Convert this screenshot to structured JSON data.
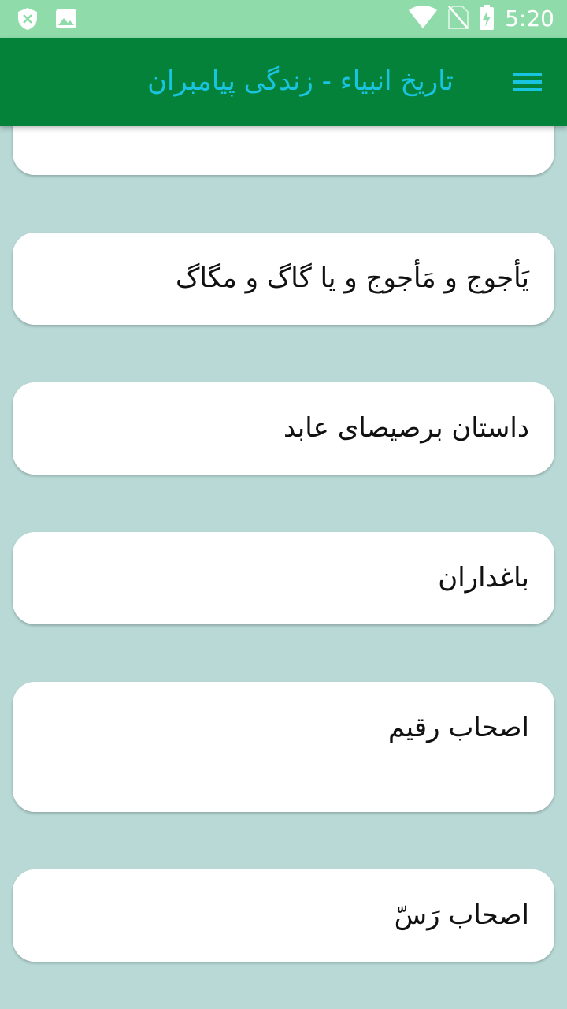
{
  "status_bar": {
    "time": "5:20",
    "icons": [
      "shield-icon",
      "image-icon",
      "wifi-icon",
      "no-sim-icon",
      "battery-charging-icon"
    ]
  },
  "app_bar": {
    "title": "تاریخ انبیاء - زندگی پیامبران",
    "menu_icon": "hamburger-menu-icon"
  },
  "items": [
    {
      "label": ""
    },
    {
      "label": "یَأجوج و مَأجوج و یا گاگ و مگاگ"
    },
    {
      "label": "داستان برصیصای عابد"
    },
    {
      "label": "باغداران"
    },
    {
      "label": "اصحاب رقیم"
    },
    {
      "label": "اصحاب رَسّ"
    }
  ],
  "colors": {
    "status_bar": "#8fdcaa",
    "app_bar": "#04823a",
    "title_accent": "#19c4e0",
    "background": "#b8d9d6",
    "card": "#ffffff"
  }
}
